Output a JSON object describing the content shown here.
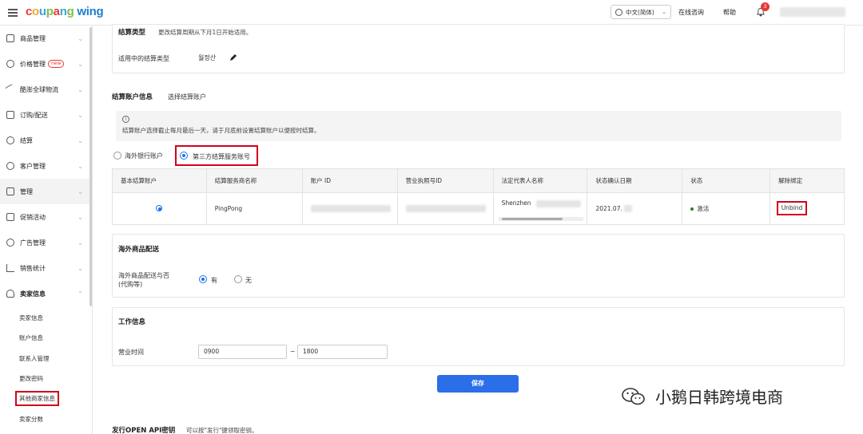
{
  "header": {
    "logo_parts": [
      "c",
      "o",
      "u",
      "p",
      "a",
      "n",
      "g",
      " ",
      "w",
      "i",
      "n",
      "g"
    ],
    "language": "中文(简体)",
    "online_consult": "在线咨询",
    "help": "帮助",
    "notification_count": "3"
  },
  "sidebar": {
    "items": [
      {
        "label": "商品管理",
        "icon": "box-icon"
      },
      {
        "label": "价格管理",
        "icon": "price-icon",
        "tag": "new"
      },
      {
        "label": "酷澎全球物流",
        "icon": "plane-icon"
      },
      {
        "label": "订购/配送",
        "icon": "truck-icon"
      },
      {
        "label": "结算",
        "icon": "won-icon"
      },
      {
        "label": "客户管理",
        "icon": "user-icon"
      },
      {
        "label": "管理",
        "icon": "cart-icon"
      },
      {
        "label": "促销活动",
        "icon": "gift-icon"
      },
      {
        "label": "广告管理",
        "icon": "ad-icon"
      },
      {
        "label": "销售统计",
        "icon": "chart-icon"
      },
      {
        "label": "卖家信息",
        "icon": "person-icon"
      }
    ],
    "subitems": [
      "卖家信息",
      "账户信息",
      "联系人管理",
      "更改密码",
      "其他商家信息",
      "卖家分数"
    ]
  },
  "settlement_type": {
    "title": "结算类型",
    "note": "更改结算周期从下月1日开始适用。",
    "label": "适用中的结算类型",
    "value": "월정산"
  },
  "settlement_account": {
    "title": "结算账户信息",
    "select_label": "选择结算账户",
    "info_text": "结算账户选择截止每月最后一天，请于月底前设置结算账户以便按时结算。",
    "info_mark": "i",
    "options": [
      "海外银行账户",
      "第三方结算服务账号"
    ],
    "table": {
      "headers": [
        "基本结算账户",
        "结算服务商名称",
        "账户 ID",
        "营业执照号ID",
        "法定代表人名称",
        "状态确认日期",
        "状态",
        "解除绑定"
      ],
      "row": {
        "provider": "PingPong",
        "rep_name": "Shenzhen",
        "date": "2021.07.",
        "status": "激活",
        "unbind": "Unbind"
      }
    }
  },
  "overseas": {
    "title": "海外商品配送",
    "label": "海外商品配送与否\n(代购等)",
    "yes": "有",
    "no": "无"
  },
  "work": {
    "title": "工作信息",
    "hours_label": "营业时间",
    "start": "0900",
    "tilde": "~",
    "end": "1800"
  },
  "save_label": "保存",
  "api": {
    "title": "发行OPEN API密钥",
    "note": "可以按\"发行\"键领取密钥。"
  },
  "watermark": "小鹅日韩跨境电商",
  "colors": {
    "primary": "#2a6ee8",
    "highlight_red": "#d0021b",
    "active_green": "#2e7d32"
  }
}
